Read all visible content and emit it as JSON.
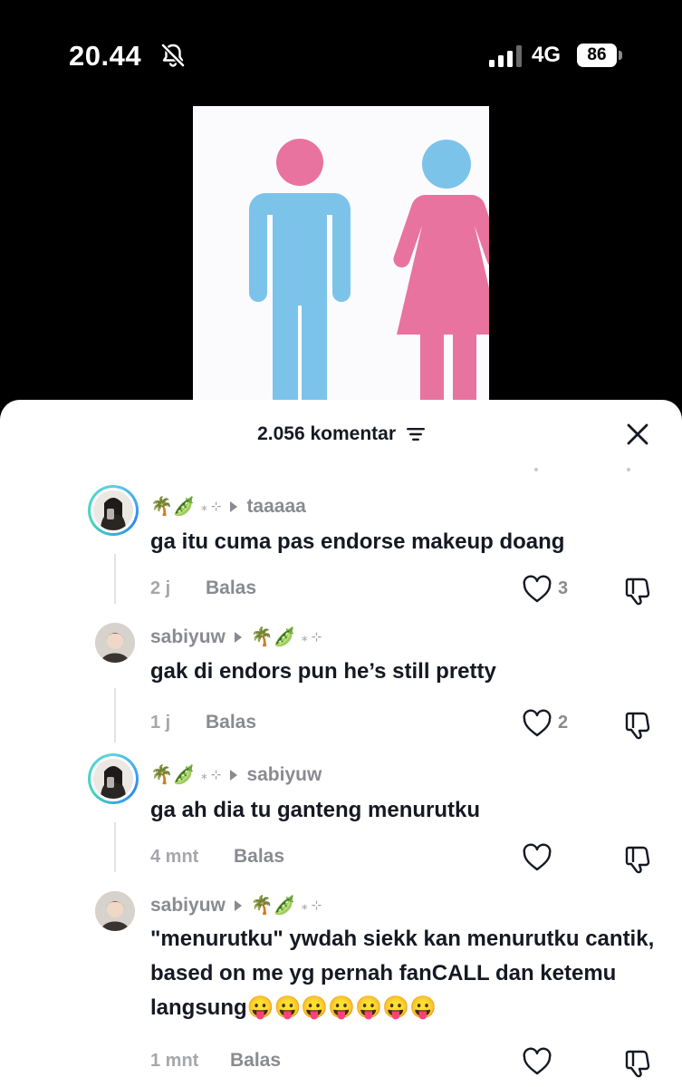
{
  "status": {
    "time": "20.44",
    "network": "4G",
    "battery": "86"
  },
  "sheet": {
    "comment_count": "2.056 komentar"
  },
  "comments": [
    {
      "user_emojis": "🌴🫛",
      "sparkle": "⁎ ⊹",
      "reply_to": "taaaaa",
      "text": "ga itu cuma pas endorse makeup doang",
      "time": "2 j",
      "reply_label": "Balas",
      "likes": "3"
    },
    {
      "username": "sabiyuw",
      "user_emojis": "🌴🫛",
      "sparkle": "⁎ ⊹",
      "text": "gak di endors pun he’s still pretty",
      "time": "1 j",
      "reply_label": "Balas",
      "likes": "2"
    },
    {
      "user_emojis": "🌴🫛",
      "sparkle": "⁎ ⊹",
      "reply_to": "sabiyuw",
      "text": "ga ah dia tu ganteng menurutku",
      "time": "4 mnt",
      "reply_label": "Balas",
      "likes": ""
    },
    {
      "username": "sabiyuw",
      "user_emojis": "🌴🫛",
      "sparkle": "⁎ ⊹",
      "text": "\"menurutku\" ywdah siekk kan menurutku cantik, based on me yg pernah fanCALL dan ketemu langsung😛😛😛😛😛😛😛",
      "time": "1 mnt",
      "reply_label": "Balas",
      "likes": ""
    }
  ],
  "colors": {
    "male_figure": "#7cc3ea",
    "female_figure": "#e8739f",
    "ring": "#2f8af5"
  },
  "icons": {
    "bell": "bell-slash-icon",
    "signal": "signal-bars-icon",
    "battery": "battery-icon",
    "filter": "filter-lines-icon",
    "close": "close-icon",
    "like": "heart-icon",
    "dislike": "thumbs-down-icon"
  }
}
